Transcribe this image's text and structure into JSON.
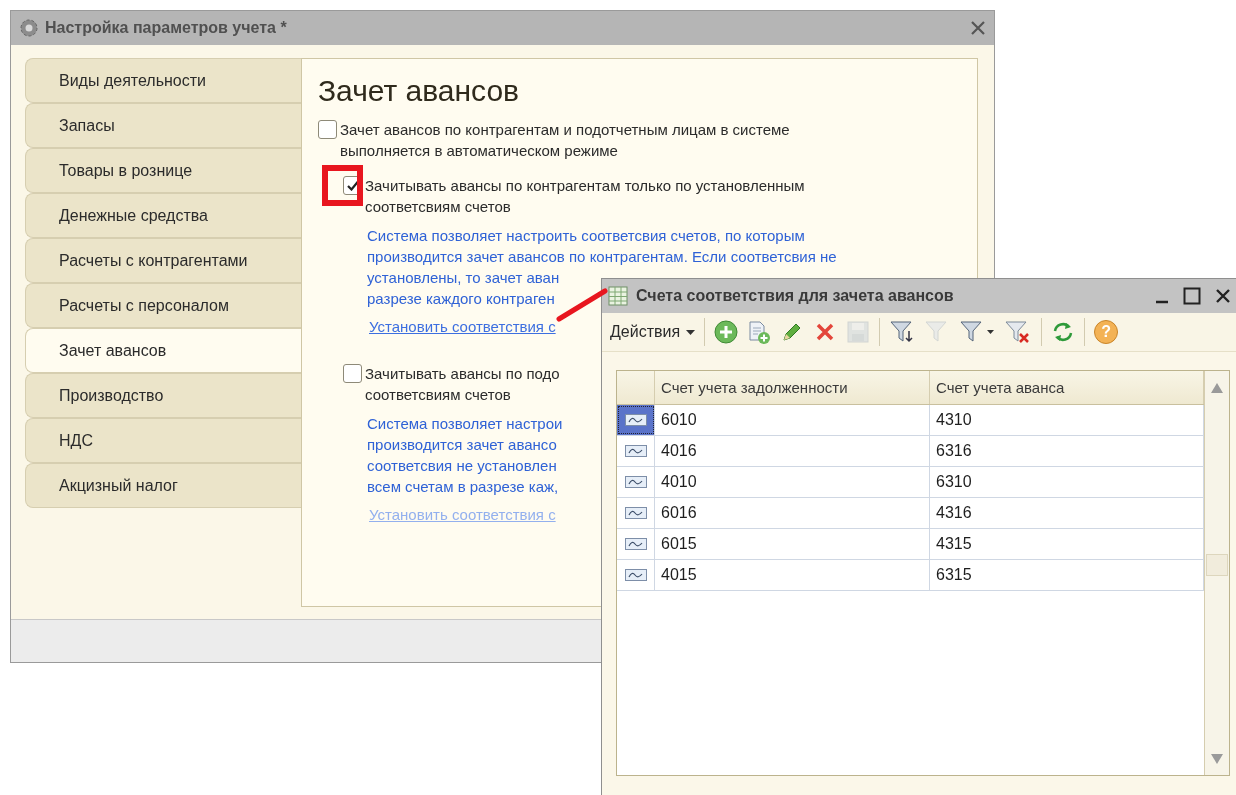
{
  "main_window": {
    "title": "Настройка параметров учета *",
    "sidebar": {
      "items": [
        {
          "label": "Виды деятельности",
          "selected": false
        },
        {
          "label": "Запасы",
          "selected": false
        },
        {
          "label": "Товары в рознице",
          "selected": false
        },
        {
          "label": "Денежные средства",
          "selected": false
        },
        {
          "label": "Расчеты с контрагентами",
          "selected": false
        },
        {
          "label": "Расчеты с персоналом",
          "selected": false
        },
        {
          "label": "Зачет авансов",
          "selected": true
        },
        {
          "label": "Производство",
          "selected": false
        },
        {
          "label": "НДС",
          "selected": false
        },
        {
          "label": "Акцизный налог",
          "selected": false
        }
      ]
    },
    "section_title": "Зачет авансов",
    "options": [
      {
        "checked": false,
        "highlighted": false,
        "label_lines": [
          "Зачет авансов по контрагентам и подотчетным лицам в системе",
          "выполняется в автоматическом режиме"
        ],
        "children": [
          {
            "checked": true,
            "highlighted": true,
            "label_lines": [
              "Зачитывать авансы по контрагентам только по установленным",
              "соответсвиям счетов"
            ],
            "note_lines": [
              "Система позволяет настроить соответсвия счетов, по которым",
              "производится зачет авансов по контрагентам. Если соответсвия не",
              "установлены, то зачет аван",
              "разрезе каждого контраген"
            ],
            "link": {
              "label": "Установить соответствия с",
              "disabled": false
            }
          },
          {
            "checked": false,
            "highlighted": false,
            "label_lines": [
              "Зачитывать авансы по подо",
              "соответсвиям счетов"
            ],
            "note_lines": [
              "Система позволяет настрои",
              "производится зачет авансо",
              "соответсвия не установлен",
              "всем счетам в разрезе каж,"
            ],
            "link": {
              "label": "Установить соответствия с",
              "disabled": true
            }
          }
        ]
      }
    ]
  },
  "list_window": {
    "title": "Счета соответствия для зачета авансов",
    "toolbar": [
      {
        "kind": "menu",
        "label": "Действия",
        "disabled": false
      },
      {
        "kind": "separator"
      },
      {
        "kind": "add",
        "disabled": false
      },
      {
        "kind": "copy",
        "disabled": false
      },
      {
        "kind": "edit",
        "disabled": false
      },
      {
        "kind": "delete",
        "disabled": false
      },
      {
        "kind": "save",
        "disabled": true
      },
      {
        "kind": "separator"
      },
      {
        "kind": "filter-apply",
        "disabled": false
      },
      {
        "kind": "filter",
        "disabled": true
      },
      {
        "kind": "filter-menu",
        "disabled": false
      },
      {
        "kind": "filter-clear",
        "disabled": false
      },
      {
        "kind": "separator"
      },
      {
        "kind": "refresh",
        "disabled": false
      },
      {
        "kind": "separator"
      },
      {
        "kind": "help",
        "label": "?",
        "disabled": false
      }
    ],
    "table": {
      "columns": [
        "Счет учета задолженности",
        "Счет учета аванса"
      ],
      "rows": [
        {
          "cells": [
            "6010",
            "4310"
          ],
          "selected": true
        },
        {
          "cells": [
            "4016",
            "6316"
          ],
          "selected": false
        },
        {
          "cells": [
            "4010",
            "6310"
          ],
          "selected": false
        },
        {
          "cells": [
            "6016",
            "4316"
          ],
          "selected": false
        },
        {
          "cells": [
            "6015",
            "4315"
          ],
          "selected": false
        },
        {
          "cells": [
            "4015",
            "6315"
          ],
          "selected": false
        }
      ]
    }
  }
}
